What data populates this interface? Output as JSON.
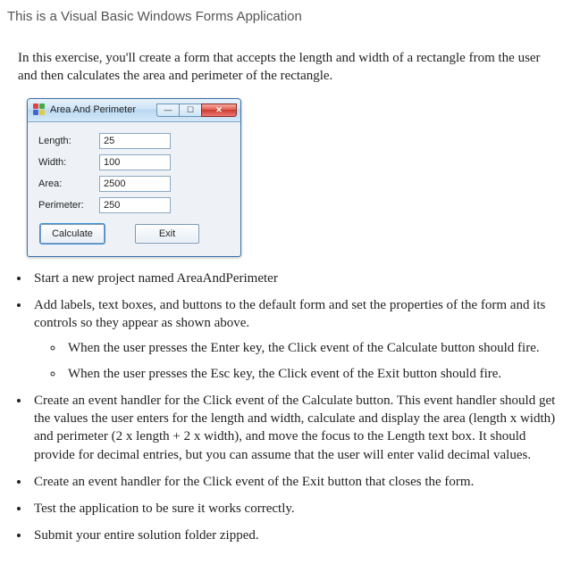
{
  "heading": "This is a Visual Basic Windows Forms Application",
  "intro": "In this exercise, you'll create a form that accepts the length and width of a rectangle from the user and then calculates the area and perimeter of the rectangle.",
  "window": {
    "title": "Area And Perimeter",
    "minimize_glyph": "—",
    "maximize_glyph": "☐",
    "close_glyph": "✕",
    "labels": {
      "length": "Length:",
      "width": "Width:",
      "area": "Area:",
      "perimeter": "Perimeter:"
    },
    "values": {
      "length": "25",
      "width": "100",
      "area": "2500",
      "perimeter": "250"
    },
    "buttons": {
      "calculate": "Calculate",
      "exit": "Exit"
    }
  },
  "bullets": {
    "b1": "Start a new project named AreaAndPerimeter",
    "b2": "Add labels, text boxes, and buttons to the default form and set the properties of the form and its controls so they appear as shown above.",
    "b2a": "When the user presses the Enter key, the Click event of the Calculate button should fire.",
    "b2b": "When the user presses the Esc key, the Click event of the Exit button should fire.",
    "b3": "Create an event handler for the Click event of the Calculate button. This event handler should get the values the user enters for the length and width, calculate and display the area (length x width) and perimeter (2 x length + 2 x width), and move the focus to the Length text box. It should provide for decimal entries, but you can assume that the user will enter valid decimal values.",
    "b4": "Create an event handler for the Click event of the Exit button that closes the form.",
    "b5": "Test the application to be sure it works correctly.",
    "b6": "Submit your entire solution folder zipped."
  }
}
